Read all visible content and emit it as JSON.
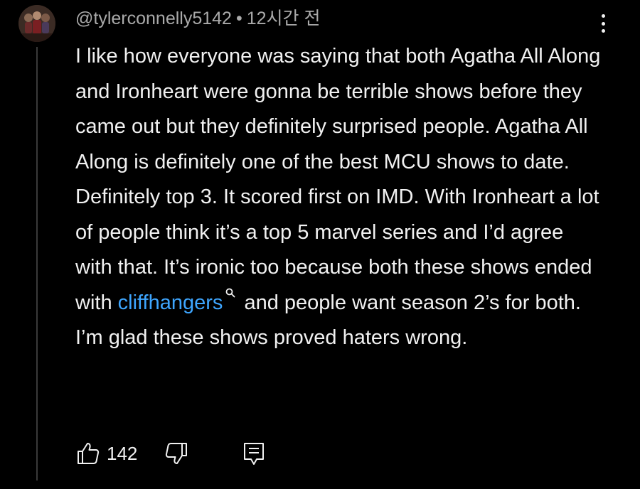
{
  "comment": {
    "author": "@tylerconnelly5142",
    "separator": "•",
    "time": "12시간 전",
    "text_before_link": "I like how everyone was saying that both Agatha All Along and Ironheart were gonna be terrible shows before they came out but they definitely surprised people. Agatha All Along is definitely one of the best MCU shows to date. Definitely top 3. It scored first on IMD. With Ironheart a lot of people think it’s a top 5 marvel series and I’d agree with that. It’s ironic too because both these shows ended with ",
    "link_text": "cliffhangers",
    "text_after_link": " and people want season 2’s for both. I’m glad these shows proved haters wrong.",
    "like_count": "142"
  },
  "icons": {
    "avatar": "avatar-image",
    "more": "more-vertical-icon",
    "search": "search-icon",
    "like": "thumbs-up-icon",
    "dislike": "thumbs-down-icon",
    "reply": "reply-icon"
  },
  "colors": {
    "background": "#000000",
    "text": "#f1f1f1",
    "meta": "#aaaaaa",
    "link": "#3ea6ff"
  }
}
